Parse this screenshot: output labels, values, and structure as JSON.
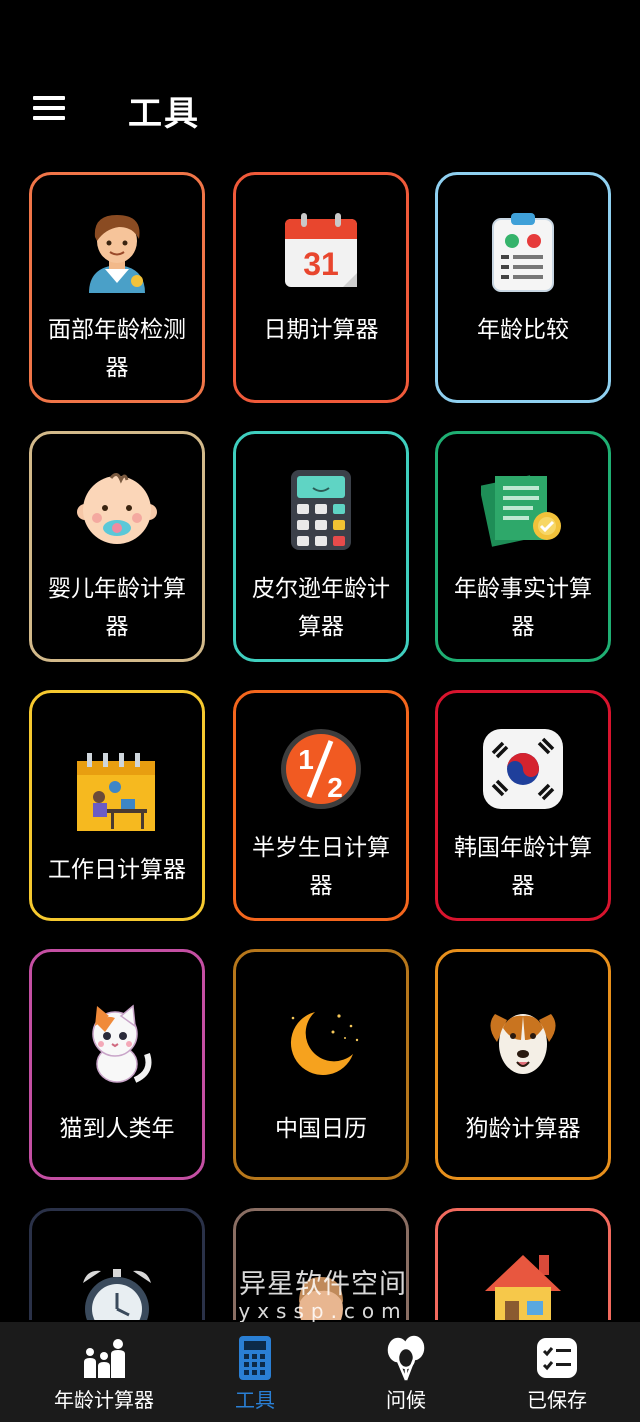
{
  "header": {
    "title": "工具",
    "menu_icon": "hamburger-menu-icon"
  },
  "tools": [
    {
      "label": "面部年龄检测器",
      "icon": "boy-face-icon",
      "border": "#f07548"
    },
    {
      "label": "日期计算器",
      "icon": "calendar-31-icon",
      "border": "#f05a3a"
    },
    {
      "label": "年龄比较",
      "icon": "clipboard-compare-icon",
      "border": "#8fd0f0"
    },
    {
      "label": "婴儿年龄计算器",
      "icon": "baby-pacifier-icon",
      "border": "#d2b98a"
    },
    {
      "label": "皮尔逊年龄计算器",
      "icon": "calculator-icon",
      "border": "#3fcfbf"
    },
    {
      "label": "年龄事实计算器",
      "icon": "certificate-document-icon",
      "border": "#1faf73"
    },
    {
      "label": "工作日计算器",
      "icon": "work-desk-calendar-icon",
      "border": "#f6c92f"
    },
    {
      "label": "半岁生日计算器",
      "icon": "half-fraction-icon",
      "border": "#f4661d"
    },
    {
      "label": "韩国年龄计算器",
      "icon": "korea-flag-icon",
      "border": "#d8142e"
    },
    {
      "label": "猫到人类年",
      "icon": "cat-icon",
      "border": "#c44fa3"
    },
    {
      "label": "中国日历",
      "icon": "crescent-moon-icon",
      "border": "#b7771b"
    },
    {
      "label": "狗龄计算器",
      "icon": "dog-icon",
      "border": "#e8901c"
    },
    {
      "label": "",
      "icon": "alarm-clock-icon",
      "border": "#2a3148"
    },
    {
      "label": "",
      "icon": "person-icon",
      "border": "#8a6e63"
    },
    {
      "label": "",
      "icon": "house-icon",
      "border": "#f26a5e"
    }
  ],
  "watermark": {
    "line1": "异星软件空间",
    "line2": "yxssp.com"
  },
  "bottom_nav": [
    {
      "label": "年龄计算器",
      "icon": "family-age-icon",
      "active": false
    },
    {
      "label": "工具",
      "icon": "calculator-tool-icon",
      "active": true
    },
    {
      "label": "问候",
      "icon": "balloons-icon",
      "active": false
    },
    {
      "label": "已保存",
      "icon": "saved-checklist-icon",
      "active": false
    }
  ],
  "colors": {
    "background": "#000000",
    "nav_background": "#1b1b1b",
    "accent": "#2a7fd4"
  }
}
